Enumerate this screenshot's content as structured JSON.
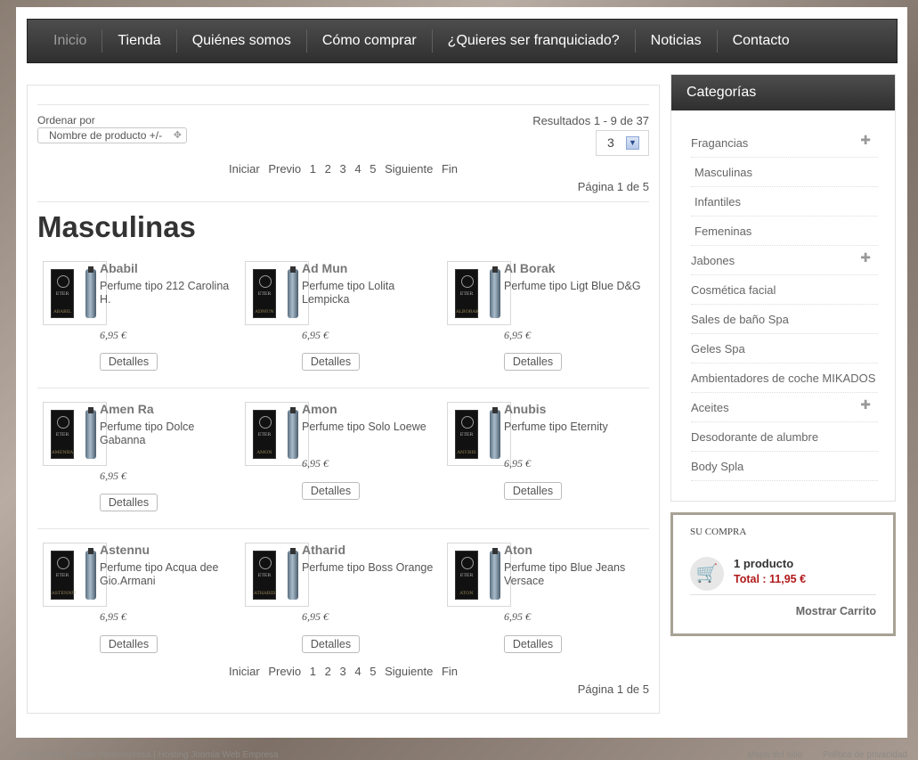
{
  "nav": {
    "items": [
      "Inicio",
      "Tienda",
      "Quiénes somos",
      "Cómo comprar",
      "¿Quieres ser franquiciado?",
      "Noticias",
      "Contacto"
    ]
  },
  "listing": {
    "order_label": "Ordenar por",
    "order_value": "Nombre de producto +/-",
    "results_text": "Resultados 1 - 9 de 37",
    "limit_value": "3",
    "pagination": [
      "Iniciar",
      "Previo",
      "1",
      "2",
      "3",
      "4",
      "5",
      "Siguiente",
      "Fin"
    ],
    "page_count": "Página 1 de 5",
    "category_title": "Masculinas"
  },
  "products": [
    {
      "name": "Ababil",
      "desc": "Perfume tipo 212 Carolina H.",
      "price": "6,95 €",
      "details": "Detalles",
      "box_label": "ABABIL"
    },
    {
      "name": "Ad Mun",
      "desc": "Perfume tipo Lolita Lempicka",
      "price": "6,95 €",
      "details": "Detalles",
      "box_label": "ADMUN"
    },
    {
      "name": "Al Borak",
      "desc": "Perfume tipo Ligt Blue D&G",
      "price": "6,95 €",
      "details": "Detalles",
      "box_label": "ALBORAK"
    },
    {
      "name": "Amen Ra",
      "desc": "Perfume tipo Dolce Gabanna",
      "price": "6,95 €",
      "details": "Detalles",
      "box_label": "AMENRA"
    },
    {
      "name": "Amon",
      "desc": "Perfume tipo Solo Loewe",
      "price": "6,95 €",
      "details": "Detalles",
      "box_label": "AMON"
    },
    {
      "name": "Anubis",
      "desc": "Perfume tipo Eternity",
      "price": "6,95 €",
      "details": "Detalles",
      "box_label": "ANUBIS"
    },
    {
      "name": "Astennu",
      "desc": "Perfume tipo Acqua dee Gio.Armani",
      "price": "6,95 €",
      "details": "Detalles",
      "box_label": "ASTENNU"
    },
    {
      "name": "Atharid",
      "desc": "Perfume tipo Boss Orange",
      "price": "6,95 €",
      "details": "Detalles",
      "box_label": "ATHARID"
    },
    {
      "name": "Aton",
      "desc": "Perfume tipo Blue Jeans Versace",
      "price": "6,95 €",
      "details": "Detalles",
      "box_label": "ATON"
    }
  ],
  "sidebar": {
    "title": "Categorías",
    "categories": [
      {
        "label": "Fragancias",
        "expandable": true,
        "sub": false
      },
      {
        "label": "Masculinas",
        "expandable": false,
        "sub": true
      },
      {
        "label": "Infantiles",
        "expandable": false,
        "sub": true
      },
      {
        "label": "Femeninas",
        "expandable": false,
        "sub": true
      },
      {
        "label": "Jabones",
        "expandable": true,
        "sub": false
      },
      {
        "label": "Cosmética facial",
        "expandable": false,
        "sub": false
      },
      {
        "label": "Sales de baño Spa",
        "expandable": false,
        "sub": false
      },
      {
        "label": "Geles Spa",
        "expandable": false,
        "sub": false
      },
      {
        "label": "Ambientadores de coche MIKADOS",
        "expandable": false,
        "sub": false
      },
      {
        "label": "Aceites",
        "expandable": true,
        "sub": false
      },
      {
        "label": "Desodorante de alumbre",
        "expandable": false,
        "sub": false
      },
      {
        "label": "Body Spla",
        "expandable": false,
        "sub": false
      }
    ]
  },
  "cart": {
    "title": "SU COMPRA",
    "count": "1 producto",
    "total": "Total : 11,95 €",
    "show": "Mostrar Carrito"
  },
  "footer": {
    "copyright": "© 2011 Pack Tienda Webempresa | Hosting Joomla Web Empresa",
    "links": [
      "Mapa del sitio",
      "Política de privacidad"
    ]
  },
  "icons": {
    "plus": "plus-icon",
    "cart": "shopping-cart-icon",
    "dropdown": "chevron-down-icon"
  },
  "colors": {
    "nav_bg": "#3a3a3a",
    "cart_total": "#b11a1a",
    "cart_border": "#a7a295"
  }
}
